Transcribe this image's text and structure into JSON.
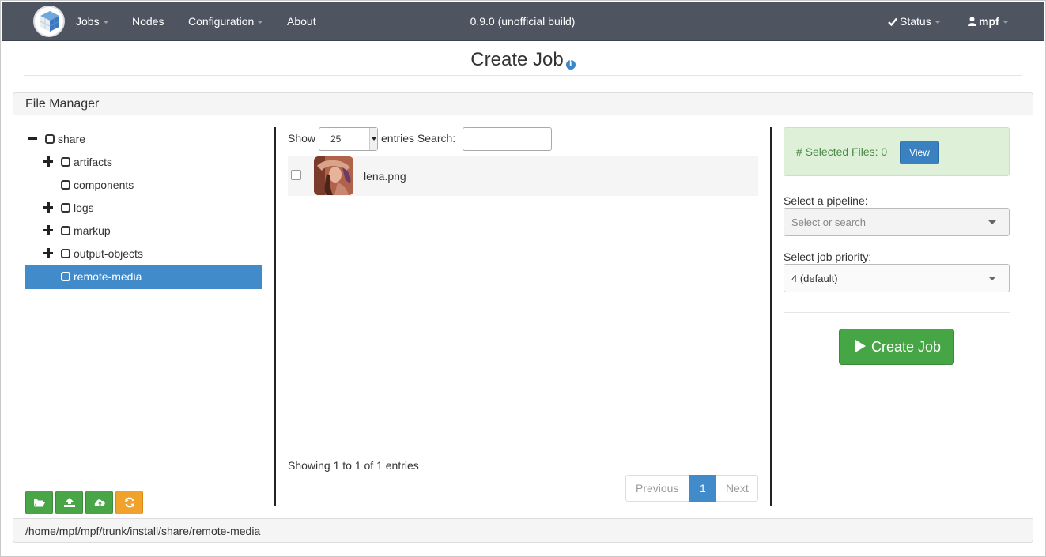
{
  "navbar": {
    "logo_icon": "cube-logo-icon",
    "items": [
      {
        "label": "Jobs",
        "has_caret": true
      },
      {
        "label": "Nodes",
        "has_caret": false
      },
      {
        "label": "Configuration",
        "has_caret": true
      },
      {
        "label": "About",
        "has_caret": false
      }
    ],
    "version": "0.9.0 (unofficial build)",
    "status_label": "Status",
    "user_label": "mpf"
  },
  "page": {
    "title": "Create Job",
    "info_icon": "info-icon"
  },
  "file_manager": {
    "heading": "File Manager",
    "tree": [
      {
        "label": "share",
        "toggle": "minus",
        "level": 0,
        "selected": false
      },
      {
        "label": "artifacts",
        "toggle": "plus",
        "level": 1,
        "selected": false
      },
      {
        "label": "components",
        "toggle": "none",
        "level": 1,
        "selected": false
      },
      {
        "label": "logs",
        "toggle": "plus",
        "level": 1,
        "selected": false
      },
      {
        "label": "markup",
        "toggle": "plus",
        "level": 1,
        "selected": false
      },
      {
        "label": "output-objects",
        "toggle": "plus",
        "level": 1,
        "selected": false
      },
      {
        "label": "remote-media",
        "toggle": "none",
        "level": 1,
        "selected": true
      }
    ],
    "tools": [
      {
        "icon": "folder-open-icon",
        "color": "#49a647"
      },
      {
        "icon": "upload-icon",
        "color": "#49a647"
      },
      {
        "icon": "cloud-upload-icon",
        "color": "#49a647"
      },
      {
        "icon": "refresh-icon",
        "color": "#f0a22b"
      }
    ],
    "table": {
      "show_label": "Show",
      "entries_value": "25",
      "entries_label": "entries Search:",
      "search_value": "",
      "files": [
        {
          "name": "lena.png",
          "checked": false
        }
      ],
      "showing_text": "Showing 1 to 1 of 1 entries",
      "pager": {
        "previous": "Previous",
        "current": "1",
        "next": "Next"
      }
    },
    "path": "/home/mpf/mpf/trunk/install/share/remote-media"
  },
  "job": {
    "selected_files_label": "# Selected Files: 0",
    "view_label": "View",
    "pipeline_label": "Select a pipeline:",
    "pipeline_placeholder": "Select or search",
    "priority_label": "Select job priority:",
    "priority_value": "4 (default)",
    "create_label": "Create Job"
  },
  "colors": {
    "navbar": "#4e5561",
    "selected_tree": "#428bca",
    "success": "#46a544",
    "primary": "#3a81c1",
    "warning": "#f0a22b"
  }
}
